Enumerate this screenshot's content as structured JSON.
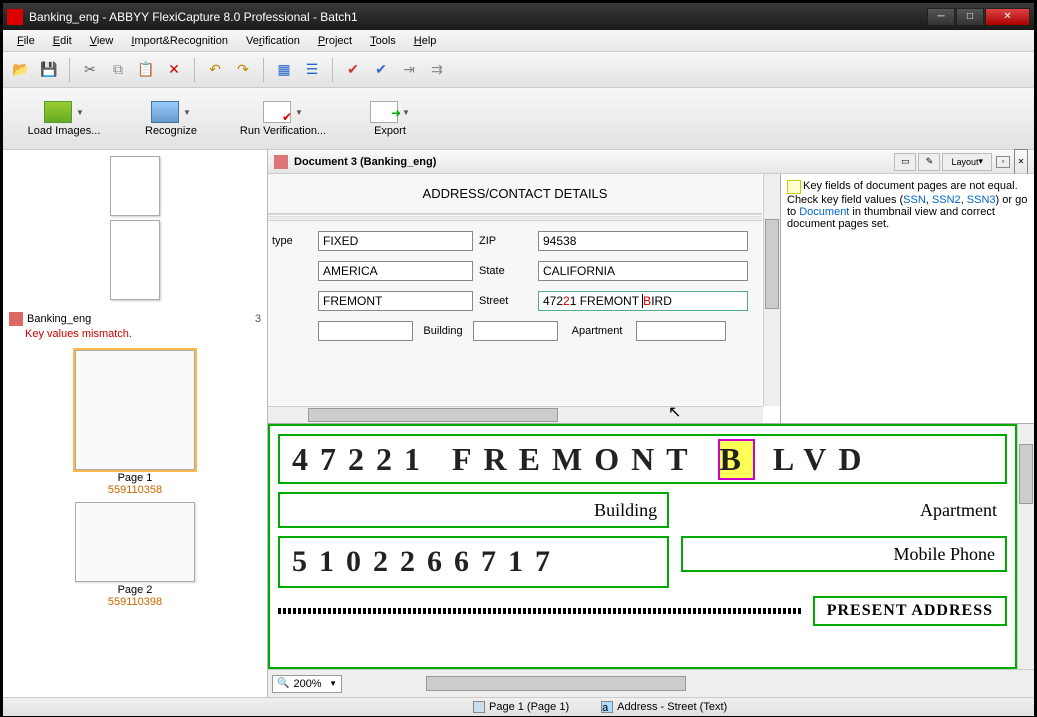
{
  "window": {
    "title": "Banking_eng - ABBYY FlexiCapture 8.0 Professional - Batch1"
  },
  "menu": {
    "file": "File",
    "edit": "Edit",
    "view": "View",
    "import": "Import&Recognition",
    "verification": "Verification",
    "project": "Project",
    "tools": "Tools",
    "help": "Help"
  },
  "toolbar_big": {
    "load": "Load Images...",
    "recognize": "Recognize",
    "run_verif": "Run Verification...",
    "export": "Export"
  },
  "sidebar": {
    "doc_name": "Banking_eng",
    "doc_count": "3",
    "doc_error": "Key values mismatch.",
    "pages": [
      {
        "label": "Page 1",
        "sub": "559110358"
      },
      {
        "label": "Page 2",
        "sub": "559110398"
      }
    ]
  },
  "doc_title": "Document  3  (Banking_eng)",
  "layout_btn": "Layout",
  "form": {
    "section": "ADDRESS/CONTACT DETAILS",
    "labels": {
      "type": "type",
      "zip": "ZIP",
      "state": "State",
      "street": "Street",
      "building": "Building",
      "apartment": "Apartment"
    },
    "values": {
      "type": "FIXED",
      "country": "AMERICA",
      "city": "FREMONT",
      "zip": "94538",
      "state": "CALIFORNIA",
      "street_pre": "472",
      "street_red": "2",
      "street_mid": "1 FREMONT ",
      "street_red2": "B",
      "street_post": "IRD"
    }
  },
  "messages": {
    "text1": "Key fields of document pages are not equal. Check key field values (",
    "ssn": "SSN",
    "sep1": ", ",
    "ssn2": "SSN2",
    "sep2": ", ",
    "ssn3": "SSN3",
    "text2": ") or go to ",
    "doc_link": "Document",
    "text3": " in thumbnail view and correct document pages set."
  },
  "image_view": {
    "hand_street": "47221 FREMONT ",
    "hand_hl": "B",
    "hand_post": "LVD",
    "building": "Building",
    "apartment": "Apartment",
    "phone": "5102266717",
    "mobile_lbl": "Mobile Phone",
    "present": "PRESENT ADDRESS",
    "zoom": "200%"
  },
  "status": {
    "page": "Page 1 (Page 1)",
    "field": "Address - Street (Text)"
  }
}
